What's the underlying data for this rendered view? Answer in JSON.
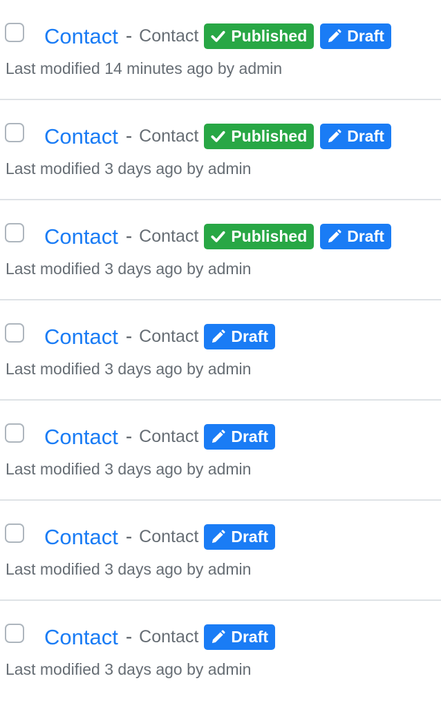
{
  "items": [
    {
      "title": "Contact",
      "separator": "-",
      "type": "Contact",
      "published_label": "Published",
      "draft_label": "Draft",
      "meta": "Last modified 14 minutes ago by admin",
      "published": true,
      "draft": true
    },
    {
      "title": "Contact",
      "separator": "-",
      "type": "Contact",
      "published_label": "Published",
      "draft_label": "Draft",
      "meta": "Last modified 3 days ago by admin",
      "published": true,
      "draft": true
    },
    {
      "title": "Contact",
      "separator": "-",
      "type": "Contact",
      "published_label": "Published",
      "draft_label": "Draft",
      "meta": "Last modified 3 days ago by admin",
      "published": true,
      "draft": true
    },
    {
      "title": "Contact",
      "separator": "-",
      "type": "Contact",
      "draft_label": "Draft",
      "meta": "Last modified 3 days ago by admin",
      "published": false,
      "draft": true
    },
    {
      "title": "Contact",
      "separator": "-",
      "type": "Contact",
      "draft_label": "Draft",
      "meta": "Last modified 3 days ago by admin",
      "published": false,
      "draft": true
    },
    {
      "title": "Contact",
      "separator": "-",
      "type": "Contact",
      "draft_label": "Draft",
      "meta": "Last modified 3 days ago by admin",
      "published": false,
      "draft": true
    },
    {
      "title": "Contact",
      "separator": "-",
      "type": "Contact",
      "draft_label": "Draft",
      "meta": "Last modified 3 days ago by admin",
      "published": false,
      "draft": true
    }
  ],
  "icons": {
    "published": "check-icon",
    "draft": "pencil-icon"
  },
  "colors": {
    "link": "#1a7cf5",
    "published": "#28a745",
    "draft": "#1a7cf5",
    "muted_text": "#666d74",
    "divider": "#dee2e6"
  }
}
